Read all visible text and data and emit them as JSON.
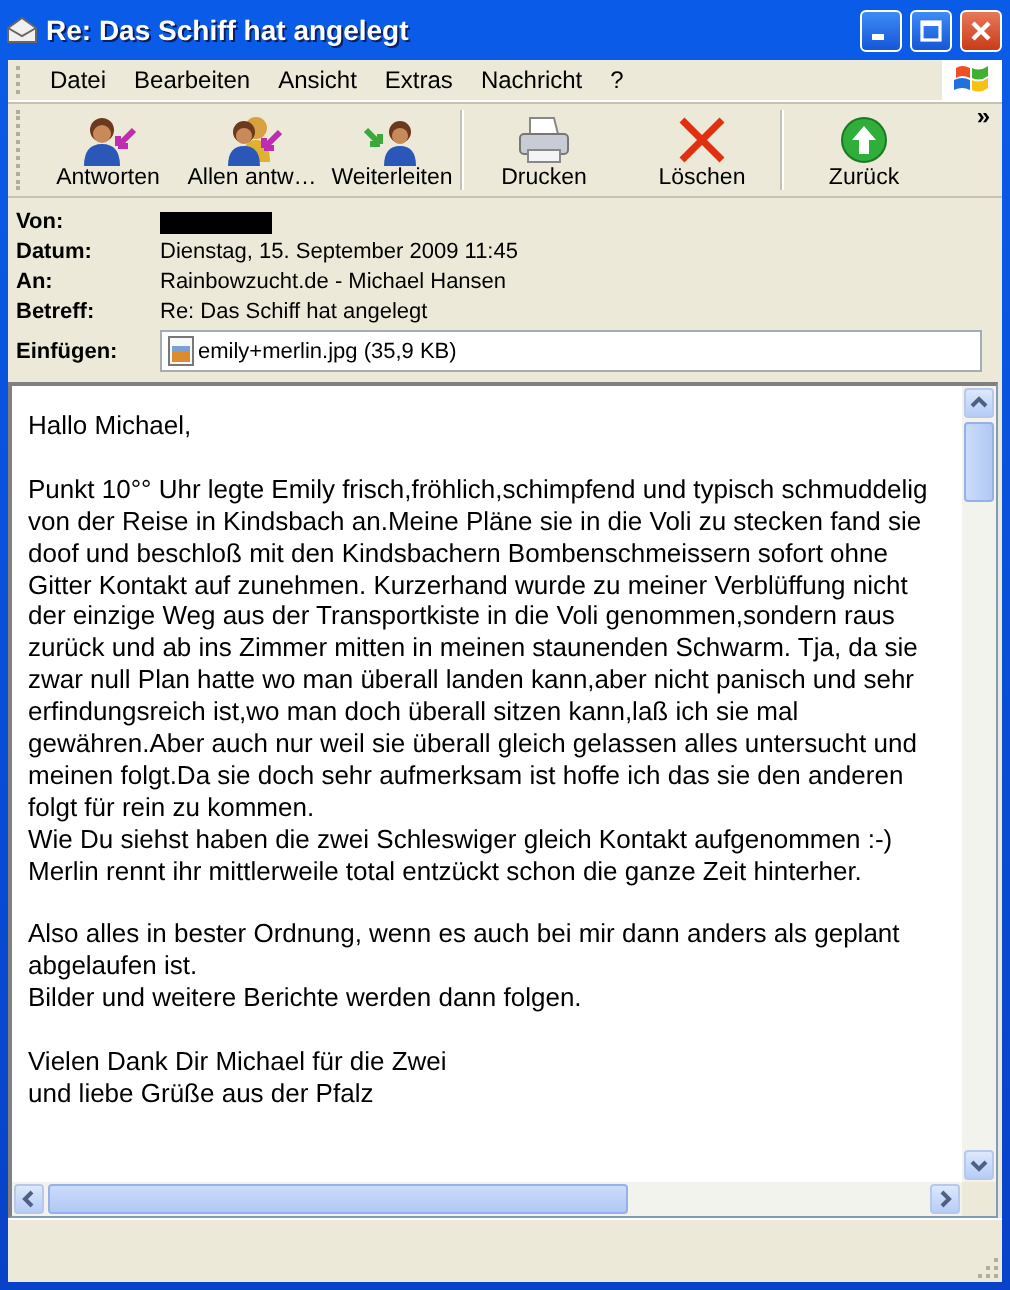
{
  "window": {
    "title": "Re: Das Schiff hat angelegt"
  },
  "menu": [
    "Datei",
    "Bearbeiten",
    "Ansicht",
    "Extras",
    "Nachricht",
    "?"
  ],
  "toolbar": {
    "overflow": "»",
    "buttons": [
      {
        "kind": "reply",
        "label": "Antworten"
      },
      {
        "kind": "reply-all",
        "label": "Allen antw…"
      },
      {
        "kind": "forward",
        "label": "Weiterleiten"
      },
      {
        "kind": "print",
        "label": "Drucken"
      },
      {
        "kind": "delete",
        "label": "Löschen"
      },
      {
        "kind": "back",
        "label": "Zurück"
      }
    ]
  },
  "header": {
    "fields": [
      {
        "kind": "redacted",
        "label": "Von:"
      },
      {
        "kind": "text",
        "label": "Datum:",
        "value": "Dienstag, 15. September 2009 11:45"
      },
      {
        "kind": "text",
        "label": "An:",
        "value": "Rainbowzucht.de - Michael Hansen"
      },
      {
        "kind": "text",
        "label": "Betreff:",
        "value": "Re: Das Schiff hat angelegt"
      },
      {
        "kind": "attachment",
        "label": "Einfügen:",
        "value": "emily+merlin.jpg (35,9 KB)"
      }
    ]
  },
  "body": {
    "paragraphs": [
      [
        "Hallo Michael,"
      ],
      [
        "Punkt 10°° Uhr legte Emily frisch,fröhlich,schimpfend und typisch schmuddelig",
        "von der Reise in Kindsbach an.Meine Pläne sie in die Voli zu stecken fand sie",
        "doof und beschloß mit den Kindsbachern Bombenschmeissern sofort ohne",
        "Gitter Kontakt auf zunehmen. Kurzerhand wurde zu meiner Verblüffung nicht",
        "der einzige Weg aus der Transportkiste in die Voli genommen,sondern raus",
        "zurück und ab ins Zimmer mitten in meinen staunenden Schwarm. Tja, da sie",
        "zwar null Plan hatte wo man überall landen kann,aber nicht panisch und sehr",
        "erfindungsreich ist,wo man doch überall sitzen kann,laß ich sie mal",
        "gewähren.Aber auch nur weil sie überall gleich gelassen alles untersucht und",
        "meinen folgt.Da sie doch sehr aufmerksam ist hoffe ich das sie den anderen",
        "folgt für rein zu kommen.",
        "Wie Du siehst haben die zwei Schleswiger gleich Kontakt aufgenommen :-)",
        "Merlin rennt ihr mittlerweile total entzückt schon die ganze Zeit hinterher."
      ],
      [
        "Also alles in bester Ordnung, wenn es auch bei mir dann anders als geplant",
        "abgelaufen ist.",
        "Bilder und weitere Berichte werden dann folgen."
      ],
      [
        "Vielen Dank Dir Michael für die Zwei",
        "und liebe Grüße aus der Pfalz"
      ]
    ]
  }
}
